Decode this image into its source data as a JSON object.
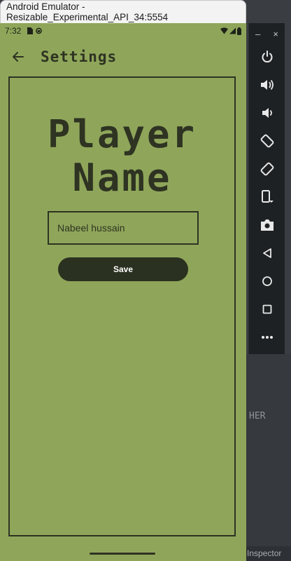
{
  "window": {
    "title": "Android Emulator - Resizable_Experimental_API_34:5554"
  },
  "status_bar": {
    "time": "7:32"
  },
  "app_bar": {
    "title": "Settings"
  },
  "heading": {
    "line1": "Player",
    "line2": "Name"
  },
  "name_field": {
    "value": "Nabeel hussain"
  },
  "save_button": {
    "label": "Save"
  },
  "emulator_toolbar": {
    "minimize": "–",
    "close": "×",
    "buttons": [
      "power",
      "volume-up",
      "volume-down",
      "rotate-left",
      "rotate-right",
      "fold",
      "screenshot",
      "back",
      "home",
      "overview",
      "more"
    ]
  },
  "side_panel": {
    "fragment_text": "HER",
    "inspector_label": "Inspector"
  },
  "colors": {
    "screen_bg": "#8fa65a",
    "ink": "#2e3322",
    "button_bg": "#2b3120"
  }
}
